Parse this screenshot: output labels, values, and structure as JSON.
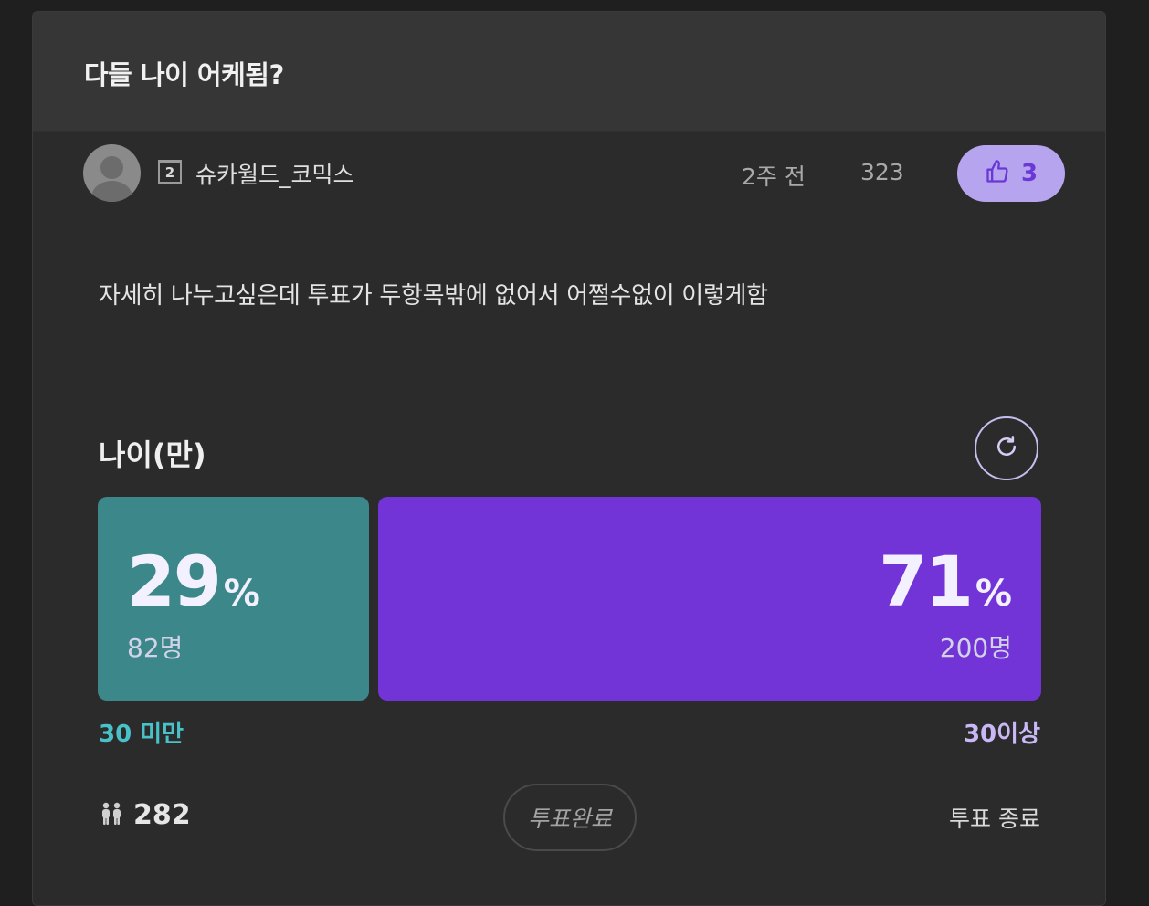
{
  "post": {
    "title": "다들 나이 어케됨?",
    "author": {
      "level": "2",
      "name": "슈카월드_코믹스"
    },
    "time": "2주 전",
    "views": "323",
    "likes": "3",
    "body": "자세히 나누고싶은데 투표가 두항목밖에 없어서 어쩔수없이 이렇게함"
  },
  "poll": {
    "question": "나이(만)",
    "options": [
      {
        "label": "30 미만",
        "percent": "29",
        "percent_sign": "%",
        "votes": "82명",
        "share": 0.29,
        "color": "#3c878a",
        "label_color": "#48c2c8"
      },
      {
        "label": "30이상",
        "percent": "71",
        "percent_sign": "%",
        "votes": "200명",
        "share": 0.71,
        "color": "#7234d6",
        "label_color": "#c9b8f5"
      }
    ],
    "participants": "282",
    "status_badge": "투표완료",
    "end_label": "투표 종료"
  },
  "icons": {
    "like": "thumbs-up-icon",
    "refresh": "refresh-icon",
    "participants": "people-icon",
    "level": "level-badge"
  },
  "colors": {
    "background": "#2b2b2b",
    "header": "#363636",
    "accent": "#7234d6",
    "like_bg": "#b7a4ee"
  }
}
